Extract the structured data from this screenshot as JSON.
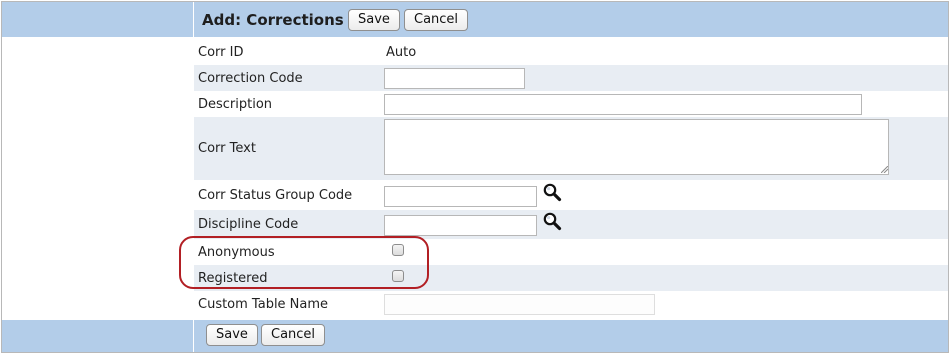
{
  "header": {
    "title": "Add: Corrections",
    "save_label": "Save",
    "cancel_label": "Cancel"
  },
  "form": {
    "corr_id": {
      "label": "Corr ID",
      "value": "Auto"
    },
    "correction_code": {
      "label": "Correction Code",
      "value": ""
    },
    "description": {
      "label": "Description",
      "value": ""
    },
    "corr_text": {
      "label": "Corr Text",
      "value": ""
    },
    "corr_status_group_code": {
      "label": "Corr Status Group Code",
      "value": ""
    },
    "discipline_code": {
      "label": "Discipline Code",
      "value": ""
    },
    "anonymous": {
      "label": "Anonymous",
      "checked": false
    },
    "registered": {
      "label": "Registered",
      "checked": false
    },
    "custom_table_name": {
      "label": "Custom Table Name",
      "value": ""
    }
  },
  "footer": {
    "save_label": "Save",
    "cancel_label": "Cancel"
  },
  "colors": {
    "band": "#b3cde9",
    "alt_row": "#e8edf3",
    "highlight": "#b21f24"
  },
  "icons": {
    "lookup": "magnifier-icon"
  }
}
